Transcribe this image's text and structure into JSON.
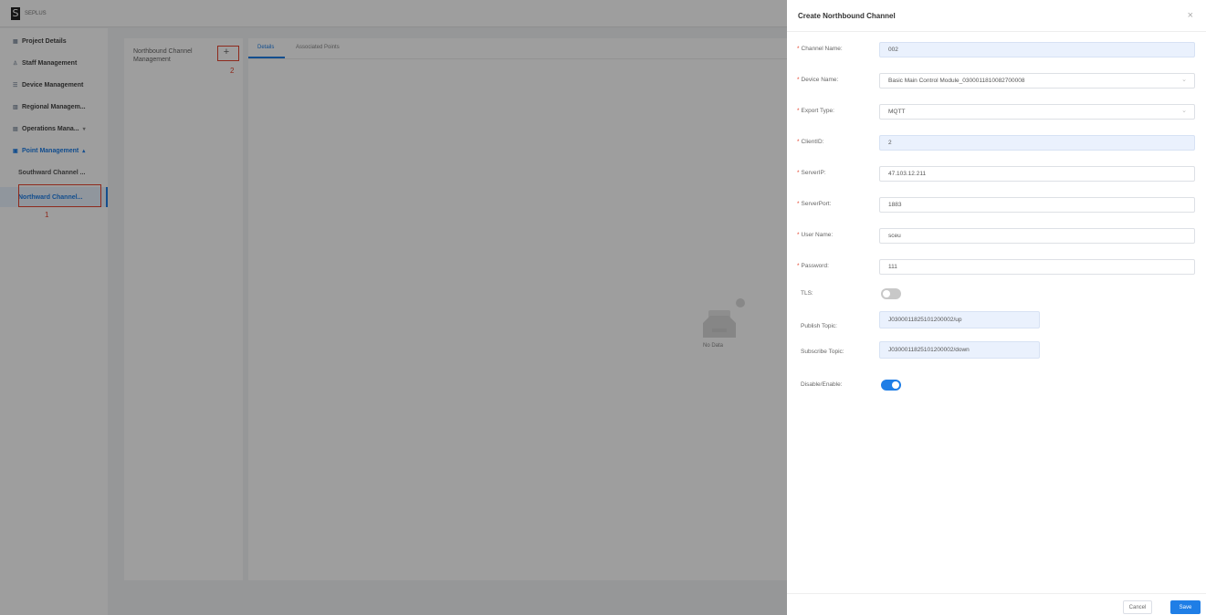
{
  "app": {
    "logo_letter": "S",
    "brand": "SEPLUS",
    "sidebar": {
      "items": [
        {
          "label": "Project Details",
          "icon": "grid-icon"
        },
        {
          "label": "Staff Management",
          "icon": "user-icon"
        },
        {
          "label": "Device Management",
          "icon": "list-icon"
        },
        {
          "label": "Regional Managem...",
          "icon": "region-icon"
        },
        {
          "label": "Operations Mana...",
          "icon": "ops-icon",
          "arrow": "▾"
        },
        {
          "label": "Point Management",
          "icon": "point-icon",
          "arrow": "▴"
        }
      ],
      "sub_items": [
        {
          "label": "Southward Channel ..."
        },
        {
          "label": "Northward Channel..."
        }
      ]
    },
    "annotations": {
      "one": "1",
      "two": "2"
    },
    "left_panel": {
      "title": "Northbound Channel Management",
      "add": "+"
    },
    "tabs": [
      "Details",
      "Associated Points"
    ],
    "empty_state": "No Data"
  },
  "drawer": {
    "title": "Create Northbound Channel",
    "close": "×",
    "required_mark": "*",
    "fields": {
      "channel_name": {
        "label": "Channel Name:",
        "value": "002"
      },
      "device_name": {
        "label": "Device Name:",
        "value": "Basic Main Control Module_0300011810082700008"
      },
      "export_type": {
        "label": "Export Type:",
        "value": "MQTT"
      },
      "client_id": {
        "label": "ClientID:",
        "value": "2"
      },
      "server_ip": {
        "label": "ServerIP:",
        "value": "47.103.12.211"
      },
      "server_port": {
        "label": "ServerPort:",
        "value": "1883"
      },
      "user_name": {
        "label": "User Name:",
        "value": "sceu"
      },
      "password": {
        "label": "Password:",
        "value": "111"
      },
      "tls": {
        "label": "TLS:",
        "state": "off"
      },
      "publish_topic": {
        "label": "Publish Topic:",
        "value": "J0300011825101200002/up"
      },
      "subscribe_topic": {
        "label": "Subscribe Topic:",
        "value": "J0300011825101200002/down"
      },
      "enable": {
        "label": "Disable/Enable:",
        "state": "on"
      }
    },
    "buttons": {
      "cancel": "Cancel",
      "save": "Save"
    }
  },
  "colors": {
    "accent": "#1f7ee6",
    "annotation": "#e5452f",
    "required": "#e5452f"
  }
}
